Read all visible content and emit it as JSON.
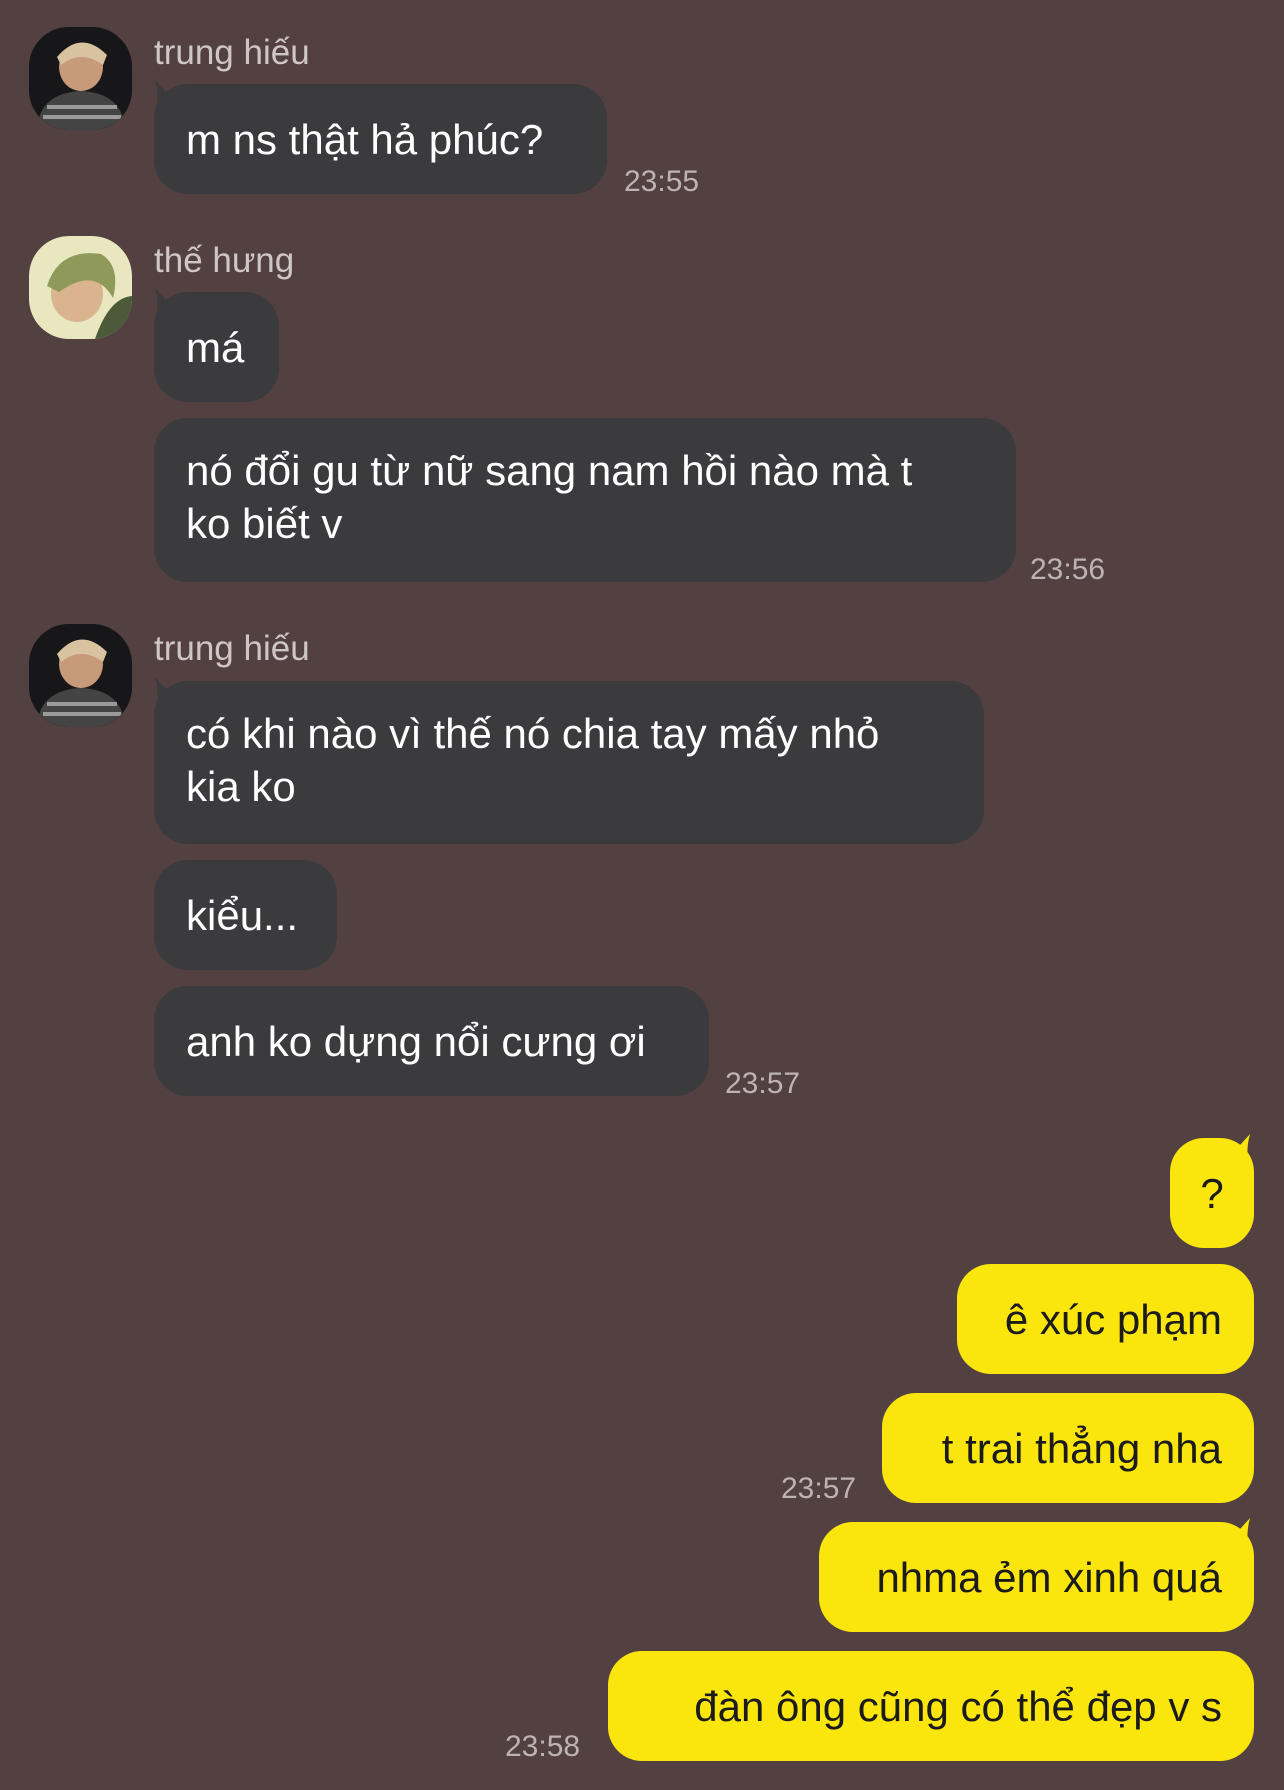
{
  "conversation": [
    {
      "sender": "trung hiếu",
      "avatar": "avatar-trung-hieu",
      "messages": [
        "m ns thật hả phúc?"
      ],
      "time": "23:55"
    },
    {
      "sender": "thế hưng",
      "avatar": "avatar-the-hung",
      "messages": [
        "má",
        "nó đổi gu từ nữ sang nam hồi nào mà t ko biết v"
      ],
      "time": "23:56"
    },
    {
      "sender": "trung hiếu",
      "avatar": "avatar-trung-hieu",
      "messages": [
        "có khi nào vì thế nó chia tay mấy nhỏ kia ko",
        "kiểu...",
        "anh ko dựng nổi cưng ơi"
      ],
      "time": "23:57"
    }
  ],
  "texts": {
    "m1": "m ns thật hả phúc?",
    "m2a": "má",
    "m2b_l1": "nó đổi gu từ nữ sang nam hồi nào mà t",
    "m2b_l2": "ko biết v",
    "m3a_l1": "có khi nào vì thế nó chia tay mấy nhỏ",
    "m3a_l2": "kia ko",
    "m3b": "kiểu...",
    "m3c": "anh ko dựng nổi cưng ơi"
  },
  "my_messages": [
    {
      "text": "?"
    },
    {
      "text": "ê xúc phạm"
    },
    {
      "text": "t trai thẳng nha",
      "time": "23:57"
    },
    {
      "text": "nhma ẻm xinh quá"
    },
    {
      "text": "đàn ông cũng có thể đẹp v s",
      "time": "23:58"
    }
  ],
  "colors": {
    "background": "#534041",
    "incoming_bubble": "#3b3a3c",
    "outgoing_bubble": "#fae50c",
    "timestamp": "#bdb3b3"
  }
}
